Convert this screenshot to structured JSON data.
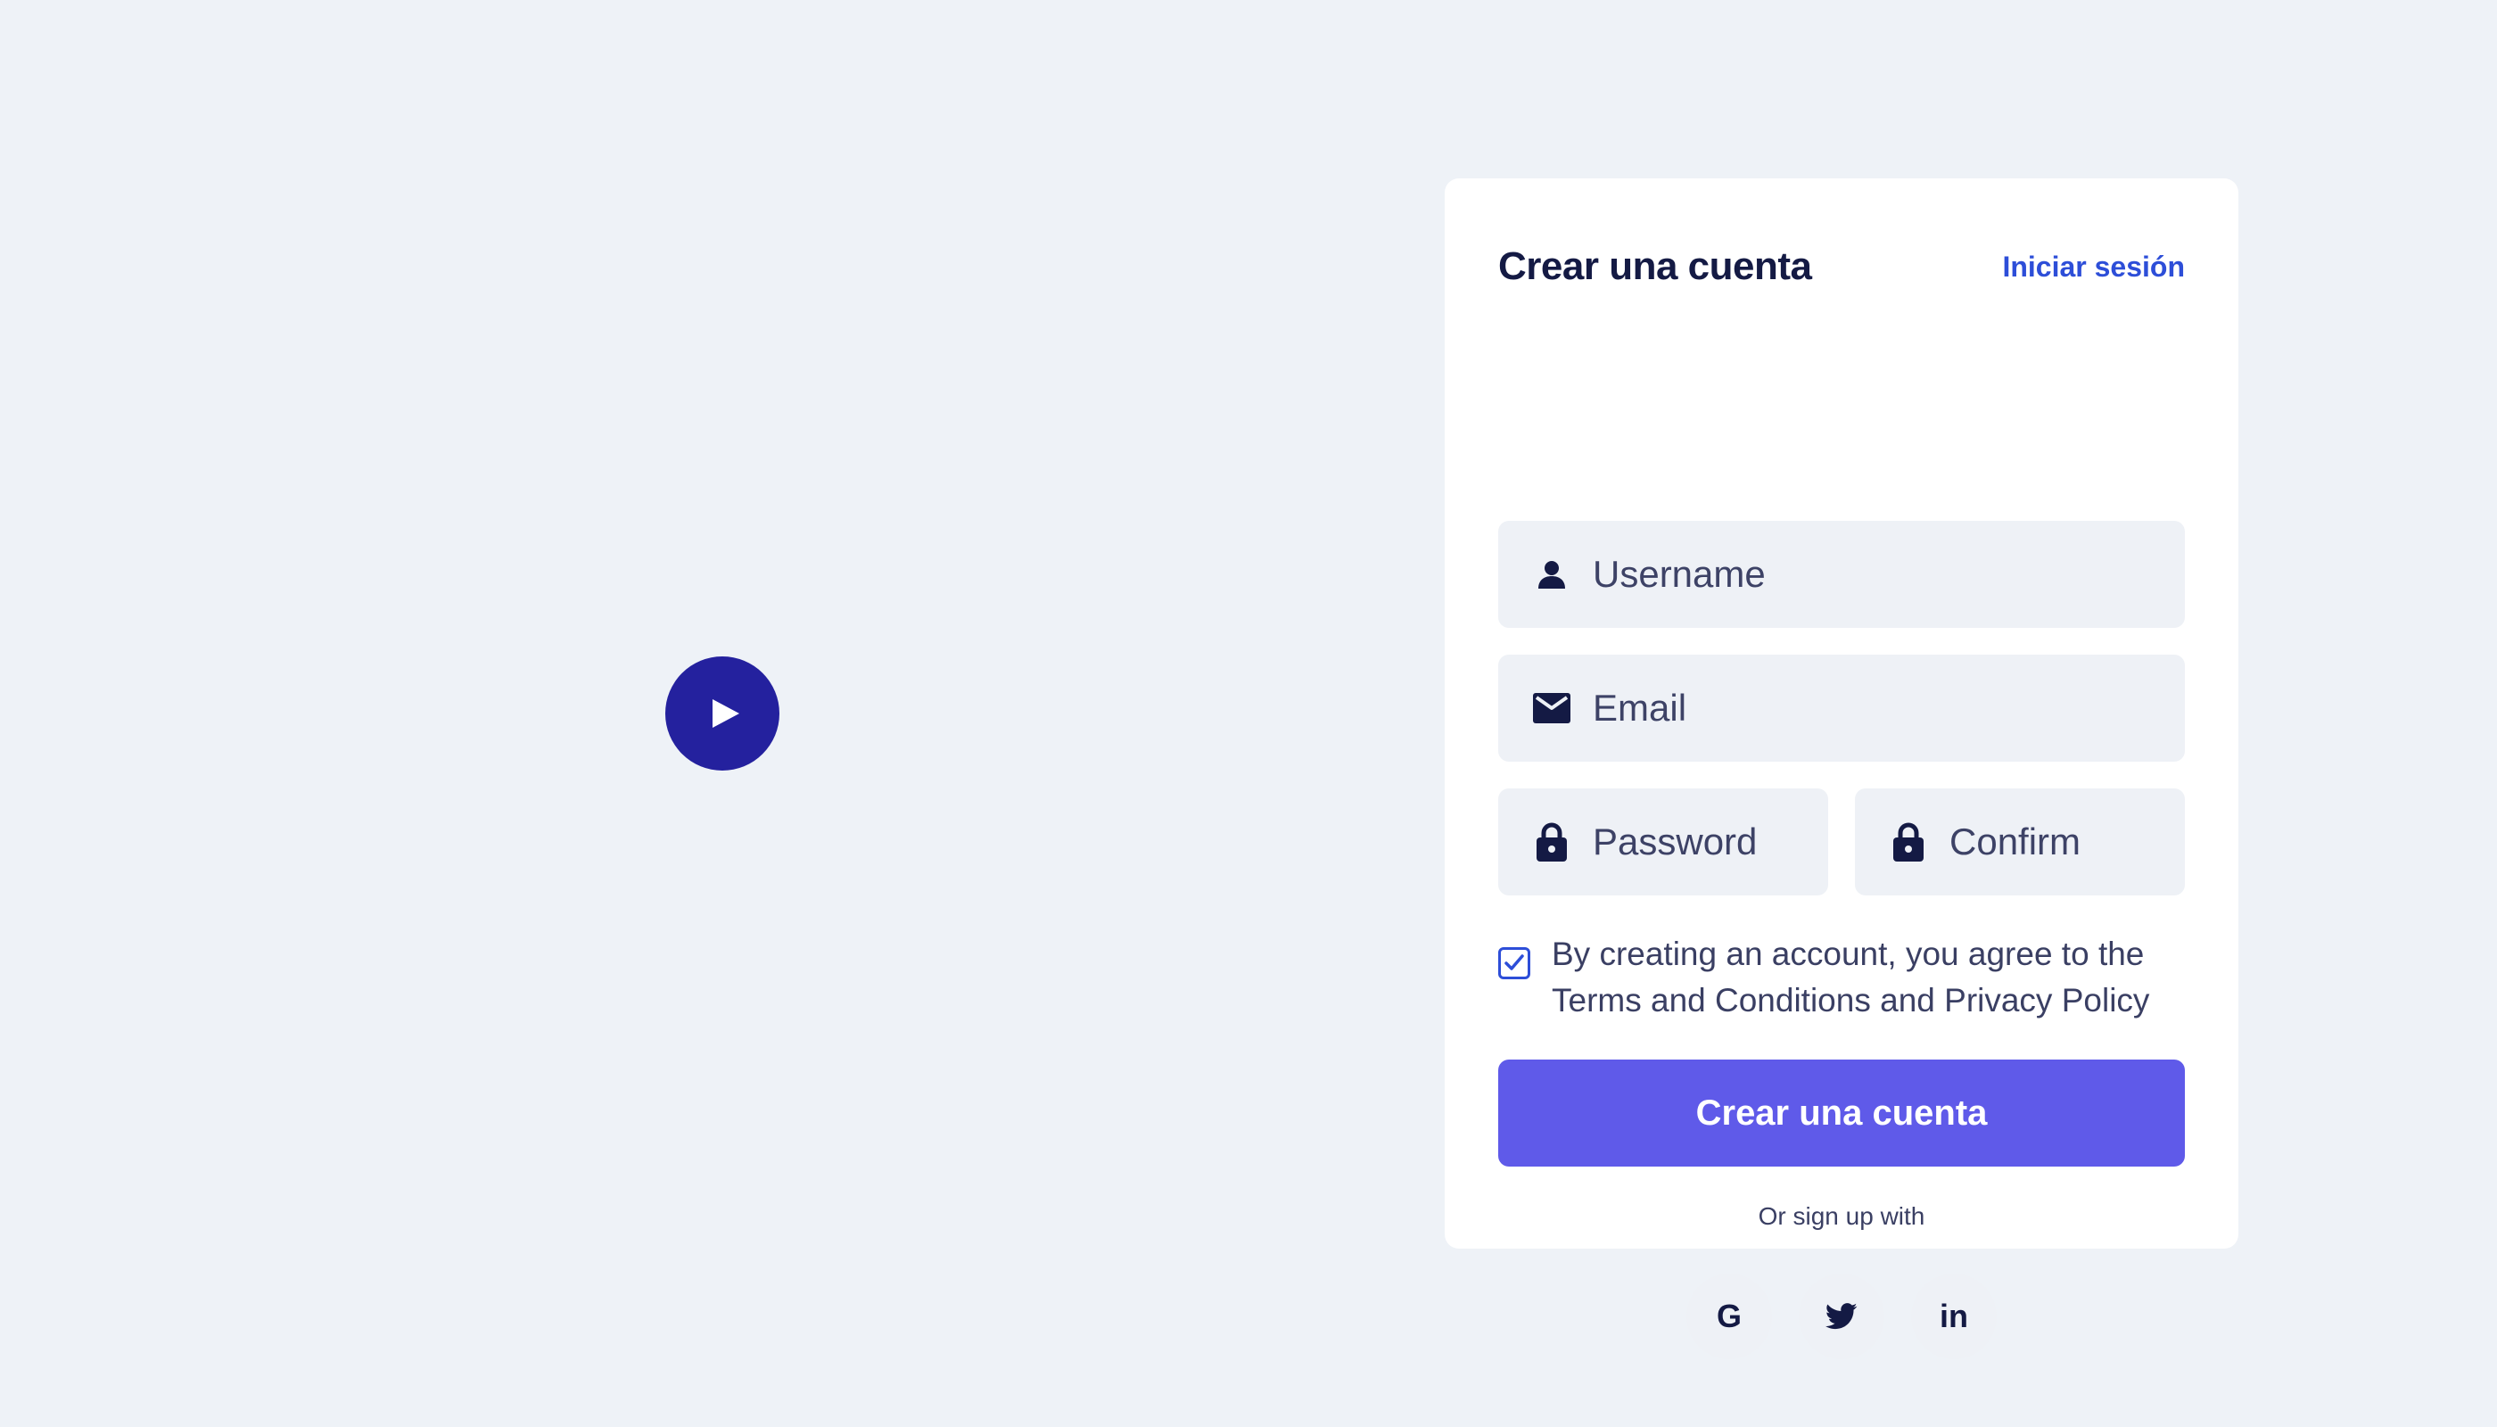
{
  "video": {
    "play_icon": "play-icon"
  },
  "card": {
    "title": "Crear una cuenta",
    "signin_link": "Iniciar sesión"
  },
  "fields": {
    "username": {
      "placeholder": "Username",
      "icon": "user-icon"
    },
    "email": {
      "placeholder": "Email",
      "icon": "mail-icon"
    },
    "password": {
      "placeholder": "Password",
      "icon": "lock-icon"
    },
    "confirm": {
      "placeholder": "Confirm",
      "icon": "lock-icon"
    }
  },
  "terms": {
    "checked": true,
    "text": "By creating an account, you agree to the Terms and Conditions and Privacy Policy"
  },
  "submit_label": "Crear una cuenta",
  "or_text": "Or sign up with",
  "social": {
    "google": {
      "glyph": "G",
      "icon": "google-icon"
    },
    "twitter": {
      "icon": "twitter-icon"
    },
    "linkedin": {
      "glyph": "in",
      "icon": "linkedin-icon"
    }
  },
  "colors": {
    "background": "#eef2f7",
    "accent": "#5f5ae9",
    "link": "#2d4ed8",
    "play_button": "#24219e",
    "text_dark": "#141a44"
  }
}
